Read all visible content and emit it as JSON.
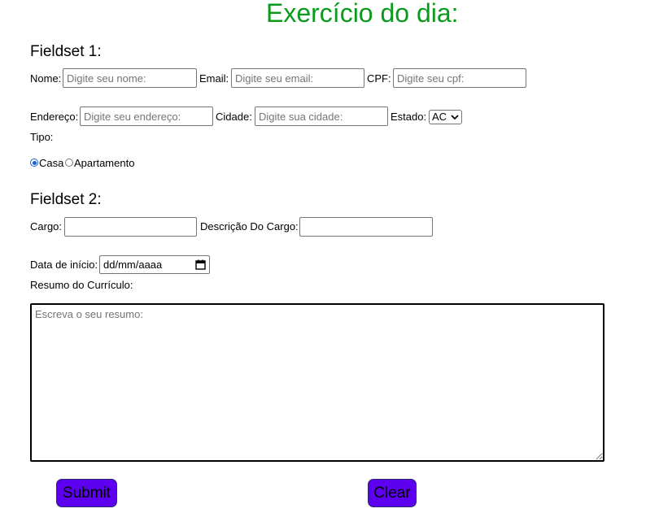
{
  "page": {
    "title": "Exercício do dia:"
  },
  "fieldset1": {
    "legend": "Fieldset 1:",
    "nome_label": "Nome:",
    "nome_placeholder": "Digite seu nome:",
    "email_label": "Email:",
    "email_placeholder": "Digite seu email:",
    "cpf_label": "CPF:",
    "cpf_placeholder": "Digite seu cpf:",
    "endereco_label": "Endereço:",
    "endereco_placeholder": "Digite seu endereço:",
    "cidade_label": "Cidade:",
    "cidade_placeholder": "Digite sua cidade:",
    "estado_label": "Estado:",
    "estado_value": "AC",
    "tipo_label": "Tipo:",
    "tipo_options": [
      {
        "label": "Casa",
        "checked": true
      },
      {
        "label": "Apartamento",
        "checked": false
      }
    ]
  },
  "fieldset2": {
    "legend": "Fieldset 2:",
    "cargo_label": "Cargo:",
    "descricao_label": "Descrição Do Cargo:",
    "data_label": "Data de início:",
    "data_placeholder": "dd/mm/aaaa",
    "resumo_label": "Resumo do Currículo:",
    "resumo_placeholder": "Escreva o seu resumo:"
  },
  "buttons": {
    "submit": "Submit",
    "clear": "Clear"
  },
  "colors": {
    "title": "#0a9a1c",
    "button_bg": "#5d00ef",
    "radio_checked": "#1a5ed4"
  },
  "icons": {
    "select_arrow": "chevron-down-icon",
    "calendar": "calendar-icon"
  }
}
